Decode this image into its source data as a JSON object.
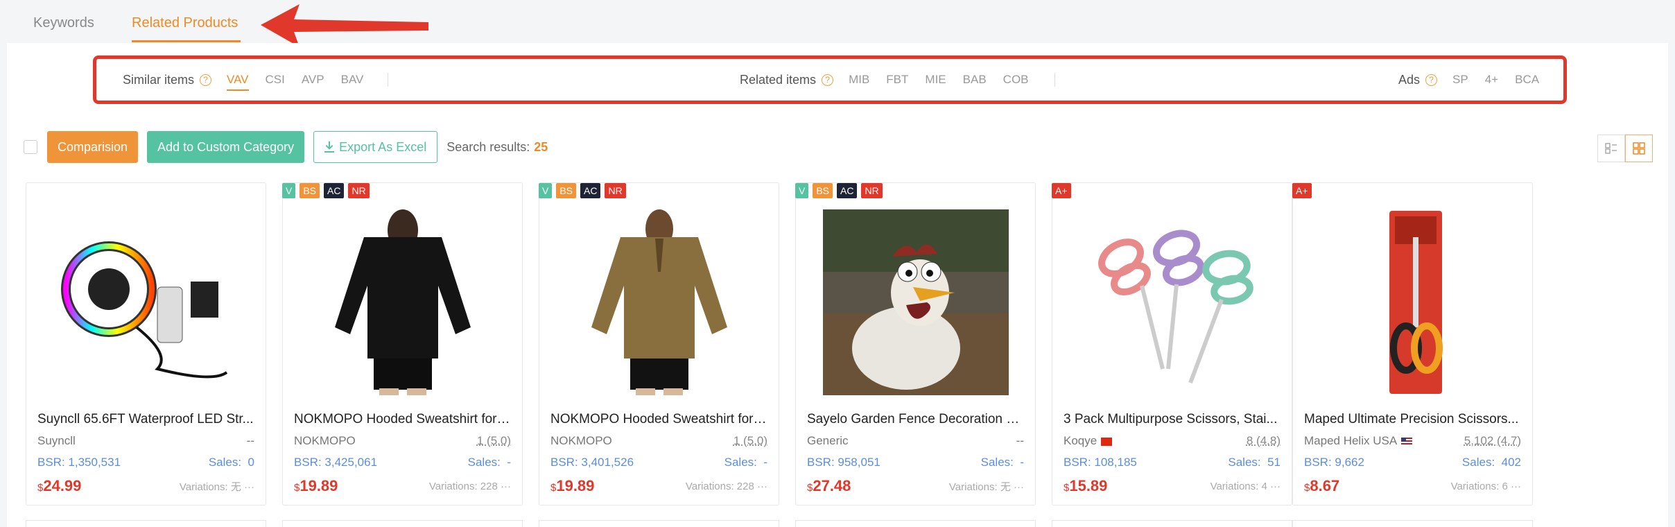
{
  "tabs": [
    {
      "label": "Keywords",
      "active": false
    },
    {
      "label": "Related Products",
      "active": true
    }
  ],
  "filters": {
    "similar": {
      "label": "Similar items",
      "options": [
        "VAV",
        "CSI",
        "AVP",
        "BAV"
      ],
      "active": "VAV"
    },
    "related": {
      "label": "Related items",
      "options": [
        "MIB",
        "FBT",
        "MIE",
        "BAB",
        "COB"
      ]
    },
    "ads": {
      "label": "Ads",
      "options": [
        "SP",
        "4+",
        "BCA"
      ]
    }
  },
  "toolbar": {
    "comparision": "Comparision",
    "add_custom": "Add to Custom Category",
    "export": "Export As Excel",
    "results_label": "Search results:",
    "results_count": "25"
  },
  "colors": {
    "accent": "#f08a24",
    "green": "#55c2a0",
    "red": "#e0392b"
  },
  "products": [
    {
      "badges": [],
      "title": "Suyncll 65.6FT Waterproof LED Str...",
      "brand": "Suyncll",
      "rating": "--",
      "bsr": "BSR: 1,350,531",
      "sales_label": "Sales:",
      "sales": "0",
      "currency": "$",
      "price": "24.99",
      "variations": "Variations: 无",
      "image": "led-strip"
    },
    {
      "badges": [
        "V",
        "BS",
        "AC",
        "NR"
      ],
      "title": "NOKMOPO Hooded Sweatshirt for ...",
      "brand": "NOKMOPO",
      "rating": "1 (5.0)",
      "bsr": "BSR: 3,425,061",
      "sales_label": "Sales:",
      "sales": "-",
      "currency": "$",
      "price": "19.89",
      "variations": "Variations: 228",
      "image": "black-sweatshirt"
    },
    {
      "badges": [
        "V",
        "BS",
        "AC",
        "NR"
      ],
      "title": "NOKMOPO Hooded Sweatshirt for ...",
      "brand": "NOKMOPO",
      "rating": "1 (5.0)",
      "bsr": "BSR: 3,401,526",
      "sales_label": "Sales:",
      "sales": "-",
      "currency": "$",
      "price": "19.89",
      "variations": "Variations: 228",
      "image": "brown-sweatshirt"
    },
    {
      "badges": [
        "V",
        "BS",
        "AC",
        "NR"
      ],
      "title": "Sayelo Garden Fence Decoration C...",
      "brand": "Generic",
      "rating": "--",
      "bsr": "BSR: 958,051",
      "sales_label": "Sales:",
      "sales": "-",
      "currency": "$",
      "price": "27.48",
      "variations": "Variations: 无",
      "image": "chicken-statue"
    },
    {
      "badges": [
        "A+"
      ],
      "title": "3 Pack Multipurpose Scissors, Stai...",
      "brand": "Koqye",
      "flag": "cn",
      "rating": "8 (4.8)",
      "bsr": "BSR: 108,185",
      "sales_label": "Sales:",
      "sales": "51",
      "currency": "$",
      "price": "15.89",
      "variations": "Variations: 4",
      "image": "scissors-3"
    },
    {
      "badges": [
        "A+"
      ],
      "title": "Maped Ultimate Precision Scissors...",
      "brand": "Maped Helix USA",
      "flag": "us",
      "rating": "5,102 (4.7)",
      "bsr": "BSR: 9,662",
      "sales_label": "Sales:",
      "sales": "402",
      "currency": "$",
      "price": "8.67",
      "variations": "Variations: 6",
      "image": "maped-scissors"
    }
  ]
}
